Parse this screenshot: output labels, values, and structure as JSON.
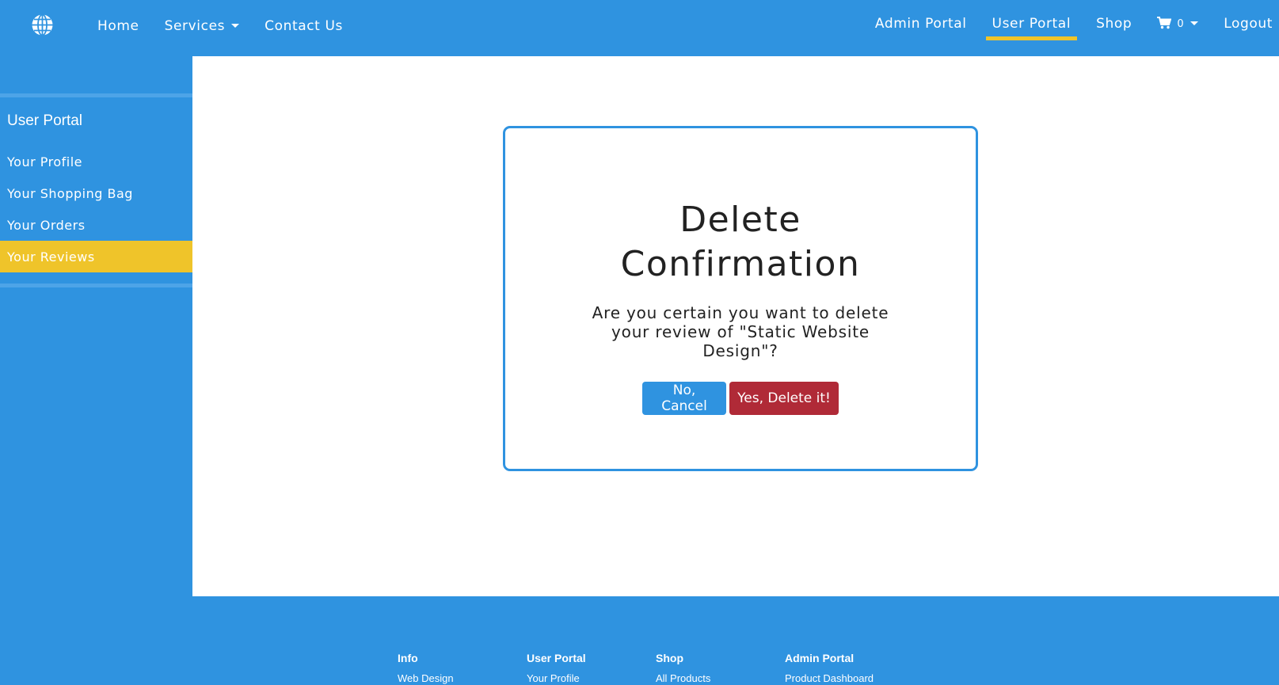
{
  "colors": {
    "primary": "#2f93e0",
    "accent": "#efc42a",
    "danger": "#b02a37",
    "content_bg": "#ffffff"
  },
  "navbar": {
    "brand_icon": "globe-icon",
    "left_links": {
      "home": "Home",
      "services": "Services",
      "contact": "Contact Us"
    },
    "right_links": {
      "admin_portal": "Admin Portal",
      "user_portal": "User Portal",
      "shop": "Shop",
      "cart_count": "0",
      "logout": "Logout"
    },
    "active": "User Portal"
  },
  "sidebar": {
    "title": "User Portal",
    "items": [
      {
        "label": "Your Profile",
        "active": false
      },
      {
        "label": "Your Shopping Bag",
        "active": false
      },
      {
        "label": "Your Orders",
        "active": false
      },
      {
        "label": "Your Reviews",
        "active": true
      }
    ]
  },
  "dialog": {
    "title": "Delete Confirmation",
    "message": "Are you certain you want to delete your review of \"Static Website Design\"?",
    "cancel_label": "No, Cancel",
    "confirm_label": "Yes, Delete it!"
  },
  "footer": {
    "columns": [
      {
        "heading": "Info",
        "link": "Web Design"
      },
      {
        "heading": "User Portal",
        "link": "Your Profile"
      },
      {
        "heading": "Shop",
        "link": "All Products"
      },
      {
        "heading": "Admin Portal",
        "link": "Product Dashboard"
      }
    ]
  }
}
